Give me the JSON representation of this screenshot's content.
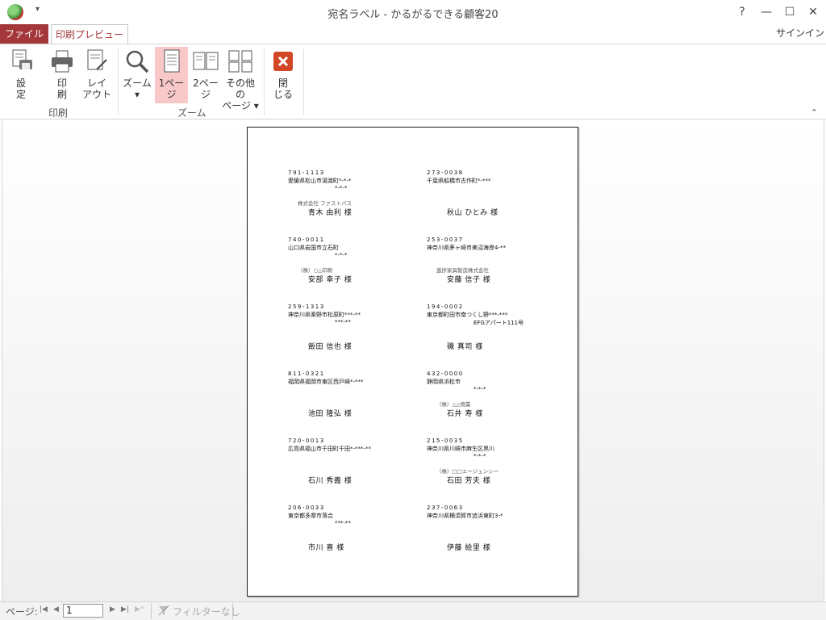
{
  "window": {
    "title": "宛名ラベル - かるがるできる顧客20",
    "qat_arrow": "▾",
    "controls": {
      "help": "?",
      "minimize": "—",
      "maximize": "☐",
      "close": "✕"
    }
  },
  "tabs": {
    "file": "ファイル",
    "preview": "印刷プレビュー",
    "signin": "サインイン"
  },
  "ribbon": {
    "groups": {
      "print": "印刷",
      "zoom": "ズーム"
    },
    "buttons": {
      "setup": {
        "line1": "設",
        "line2": "定"
      },
      "print": {
        "line1": "印",
        "line2": "刷"
      },
      "layout": {
        "line1": "レイ",
        "line2": "アウト"
      },
      "zoom": {
        "line1": "ズーム",
        "line2": "▾"
      },
      "one_page": {
        "line1": "1ペー",
        "line2": "ジ"
      },
      "two_page": {
        "line1": "2ペー",
        "line2": "ジ"
      },
      "other_pages": {
        "line1": "その他の",
        "line2": "ページ ▾"
      },
      "close": {
        "line1": "閉",
        "line2": "じる"
      }
    },
    "collapse": "⌃"
  },
  "labels": [
    {
      "zip": "791-1113",
      "addr1": "愛媛県松山市湯渡町*-*-*",
      "addr2": "*-*-*",
      "company": "株式会社 ファストパス",
      "name": "青木 由利 様"
    },
    {
      "zip": "273-0038",
      "addr1": "千葉県船橋市古作町*-***",
      "addr2": "",
      "company": "",
      "name": "秋山 ひとみ 様"
    },
    {
      "zip": "740-0011",
      "addr1": "山口県岩国市立石町",
      "addr2": "*-*-*",
      "company": "（株）○△印刷",
      "name": "安部 幸子 様"
    },
    {
      "zip": "253-0037",
      "addr1": "神奈川県茅ヶ崎市美沼海岸4-**",
      "addr2": "",
      "company": "進捗家具製造株式会社",
      "name": "安藤 信子 様"
    },
    {
      "zip": "259-1313",
      "addr1": "神奈川県秦野市松原町***-**",
      "addr2": "***-**",
      "company": "",
      "name": "飯田 信也 様"
    },
    {
      "zip": "194-0002",
      "addr1": "東京都町田市南つくし野***-***",
      "addr2": "EFGアパート111号",
      "company": "",
      "name": "磯 真司 様"
    },
    {
      "zip": "811-0321",
      "addr1": "福岡県福岡市東区西戸崎*-***",
      "addr2": "",
      "company": "",
      "name": "池田 隆弘 様"
    },
    {
      "zip": "432-0000",
      "addr1": "静岡県浜松市",
      "addr2": "*-*-*",
      "company": "（株）△△物業",
      "name": "石井 寿 様"
    },
    {
      "zip": "720-0013",
      "addr1": "広島県福山市千田町千田*-***-**",
      "addr2": "",
      "company": "",
      "name": "石川 秀義 様"
    },
    {
      "zip": "215-0035",
      "addr1": "神奈川県川崎市麻生区黒川",
      "addr2": "*-*-*",
      "company": "（株）□□エージェンシー",
      "name": "石田 芳夫 様"
    },
    {
      "zip": "206-0033",
      "addr1": "東京都多摩市落合",
      "addr2": "***-**",
      "company": "",
      "name": "市川 喜 様"
    },
    {
      "zip": "237-0063",
      "addr1": "神奈川県横須賀市追浜東町3-*",
      "addr2": "",
      "company": "",
      "name": "伊藤 絵里 様"
    }
  ],
  "statusbar": {
    "page_label": "ページ:",
    "page_value": "1",
    "filter_label": "フィルターなし",
    "nav": {
      "first": "|◀",
      "prev": "◀",
      "next": "▶",
      "last": "▶|",
      "new": "▶*"
    }
  }
}
